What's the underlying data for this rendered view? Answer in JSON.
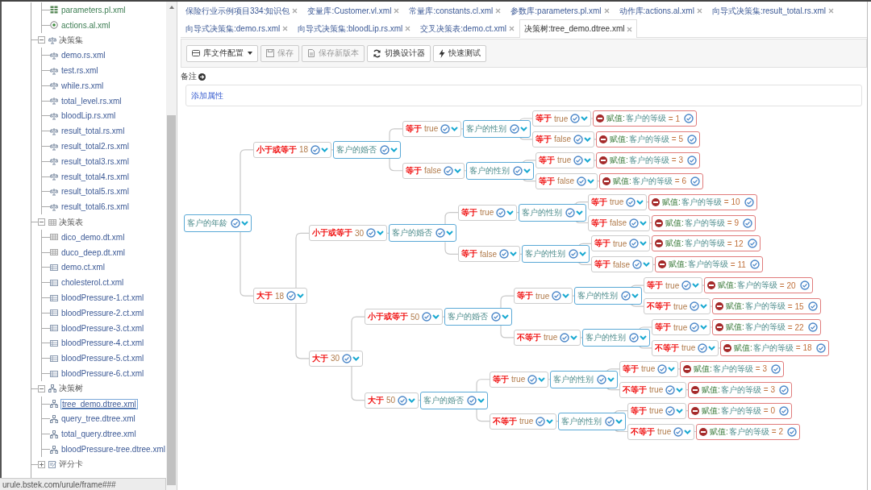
{
  "sidebar": {
    "groups": [
      {
        "children": [
          {
            "label": "parameters.pl.xml",
            "kind": "parameters",
            "selected": false
          },
          {
            "label": "actions.al.xml",
            "kind": "actions",
            "selected": false
          }
        ]
      },
      {
        "label": "决策集",
        "kind": "ruleset",
        "expanded": true,
        "children": [
          {
            "label": "demo.rs.xml",
            "kind": "ruleset",
            "selected": false
          },
          {
            "label": "test.rs.xml",
            "kind": "ruleset",
            "selected": false
          },
          {
            "label": "while.rs.xml",
            "kind": "ruleset",
            "selected": false
          },
          {
            "label": "total_level.rs.xml",
            "kind": "ruleset",
            "selected": false
          },
          {
            "label": "bloodLip.rs.xml",
            "kind": "ruleset",
            "selected": false
          },
          {
            "label": "result_total.rs.xml",
            "kind": "ruleset",
            "selected": false
          },
          {
            "label": "result_total2.rs.xml",
            "kind": "ruleset",
            "selected": false
          },
          {
            "label": "result_total3.rs.xml",
            "kind": "ruleset",
            "selected": false
          },
          {
            "label": "result_total4.rs.xml",
            "kind": "ruleset",
            "selected": false
          },
          {
            "label": "result_total5.rs.xml",
            "kind": "ruleset",
            "selected": false
          },
          {
            "label": "result_total6.rs.xml",
            "kind": "ruleset",
            "selected": false
          }
        ]
      },
      {
        "label": "决策表",
        "kind": "table",
        "expanded": true,
        "children": [
          {
            "label": "dico_demo.dt.xml",
            "kind": "table",
            "selected": false
          },
          {
            "label": "duco_deep.dt.xml",
            "kind": "table",
            "selected": false
          },
          {
            "label": "demo.ct.xml",
            "kind": "crosstab",
            "selected": false
          },
          {
            "label": "cholesterol.ct.xml",
            "kind": "crosstab",
            "selected": false
          },
          {
            "label": "bloodPressure-1.ct.xml",
            "kind": "crosstab",
            "selected": false
          },
          {
            "label": "bloodPressure-2.ct.xml",
            "kind": "crosstab",
            "selected": false
          },
          {
            "label": "bloodPressure-3.ct.xml",
            "kind": "crosstab",
            "selected": false
          },
          {
            "label": "bloodPressure-4.ct.xml",
            "kind": "crosstab",
            "selected": false
          },
          {
            "label": "bloodPressure-5.ct.xml",
            "kind": "crosstab",
            "selected": false
          },
          {
            "label": "bloodPressure-6.ct.xml",
            "kind": "crosstab",
            "selected": false
          }
        ]
      },
      {
        "label": "决策树",
        "kind": "tree",
        "expanded": true,
        "children": [
          {
            "label": "tree_demo.dtree.xml",
            "kind": "tree",
            "selected": true
          },
          {
            "label": "query_tree.dtree.xml",
            "kind": "tree",
            "selected": false
          },
          {
            "label": "total_query.dtree.xml",
            "kind": "tree",
            "selected": false
          },
          {
            "label": "bloodPressure-tree.dtree.xml",
            "kind": "tree",
            "selected": false
          }
        ]
      },
      {
        "label": "评分卡",
        "kind": "scorecard",
        "expanded": false
      }
    ]
  },
  "status_bar": "urule.bstek.com/urule/frame###",
  "tab_rows": [
    [
      {
        "label": "保险行业示例项目334:知识包",
        "selected": false
      },
      {
        "label": "变量库:Customer.vl.xml",
        "selected": false
      },
      {
        "label": "常量库:constants.cl.xml",
        "selected": false
      },
      {
        "label": "参数库:parameters.pl.xml",
        "selected": false
      },
      {
        "label": "动作库:actions.al.xml",
        "selected": false
      },
      {
        "label": "向导式决策集:result_total.rs.xml",
        "selected": false
      }
    ],
    [
      {
        "label": "向导式决策集:demo.rs.xml",
        "selected": false
      },
      {
        "label": "向导式决策集:bloodLip.rs.xml",
        "selected": false
      },
      {
        "label": "交叉决策表:demo.ct.xml",
        "selected": false
      },
      {
        "label": "决策树:tree_demo.dtree.xml",
        "selected": true
      }
    ]
  ],
  "toolbar": [
    {
      "label": "库文件配置",
      "kind": "menu",
      "disabled": false
    },
    {
      "label": "保存",
      "kind": "save",
      "disabled": true
    },
    {
      "label": "保存新版本",
      "kind": "save-as",
      "disabled": true
    },
    {
      "label": "切换设计器",
      "kind": "switch",
      "disabled": false
    },
    {
      "label": "快速测试",
      "kind": "run",
      "disabled": false
    }
  ],
  "note": {
    "label": "备注",
    "add_link": "添加属性"
  },
  "decision_tree": {
    "kind": "variable",
    "label": "客户的年龄",
    "children": [
      {
        "kind": "condition",
        "operator": "小于或等于",
        "value": "18",
        "children": [
          {
            "kind": "variable",
            "label": "客户的婚否",
            "children": [
              {
                "kind": "condition",
                "operator": "等于",
                "value": "true",
                "children": [
                  {
                    "kind": "variable",
                    "label": "客户的性别",
                    "children": [
                      {
                        "kind": "condition",
                        "operator": "等于",
                        "value": "true",
                        "children": [
                          {
                            "kind": "action",
                            "label": "赋值:",
                            "target": "客户的等级",
                            "value": "= 1"
                          }
                        ]
                      },
                      {
                        "kind": "condition",
                        "operator": "等于",
                        "value": "false",
                        "children": [
                          {
                            "kind": "action",
                            "label": "赋值:",
                            "target": "客户的等级",
                            "value": "= 5"
                          }
                        ]
                      }
                    ]
                  }
                ]
              },
              {
                "kind": "condition",
                "operator": "等于",
                "value": "false",
                "children": [
                  {
                    "kind": "variable",
                    "label": "客户的性别",
                    "children": [
                      {
                        "kind": "condition",
                        "operator": "等于",
                        "value": "true",
                        "children": [
                          {
                            "kind": "action",
                            "label": "赋值:",
                            "target": "客户的等级",
                            "value": "= 3"
                          }
                        ]
                      },
                      {
                        "kind": "condition",
                        "operator": "等于",
                        "value": "false",
                        "children": [
                          {
                            "kind": "action",
                            "label": "赋值:",
                            "target": "客户的等级",
                            "value": "= 6"
                          }
                        ]
                      }
                    ]
                  }
                ]
              }
            ]
          }
        ]
      },
      {
        "kind": "condition",
        "operator": "大于",
        "value": "18",
        "children": [
          {
            "kind": "condition",
            "operator": "小于或等于",
            "value": "30",
            "children": [
              {
                "kind": "variable",
                "label": "客户的婚否",
                "children": [
                  {
                    "kind": "condition",
                    "operator": "等于",
                    "value": "true",
                    "children": [
                      {
                        "kind": "variable",
                        "label": "客户的性别",
                        "children": [
                          {
                            "kind": "condition",
                            "operator": "等于",
                            "value": "true",
                            "children": [
                              {
                                "kind": "action",
                                "label": "赋值:",
                                "target": "客户的等级",
                                "value": "= 10"
                              }
                            ]
                          },
                          {
                            "kind": "condition",
                            "operator": "等于",
                            "value": "false",
                            "children": [
                              {
                                "kind": "action",
                                "label": "赋值:",
                                "target": "客户的等级",
                                "value": "= 9"
                              }
                            ]
                          }
                        ]
                      }
                    ]
                  },
                  {
                    "kind": "condition",
                    "operator": "等于",
                    "value": "false",
                    "children": [
                      {
                        "kind": "variable",
                        "label": "客户的性别",
                        "children": [
                          {
                            "kind": "condition",
                            "operator": "等于",
                            "value": "true",
                            "children": [
                              {
                                "kind": "action",
                                "label": "赋值:",
                                "target": "客户的等级",
                                "value": "= 12"
                              }
                            ]
                          },
                          {
                            "kind": "condition",
                            "operator": "等于",
                            "value": "false",
                            "children": [
                              {
                                "kind": "action",
                                "label": "赋值:",
                                "target": "客户的等级",
                                "value": "= 11"
                              }
                            ]
                          }
                        ]
                      }
                    ]
                  }
                ]
              }
            ]
          },
          {
            "kind": "condition",
            "operator": "大于",
            "value": "30",
            "children": [
              {
                "kind": "condition",
                "operator": "小于或等于",
                "value": "50",
                "children": [
                  {
                    "kind": "variable",
                    "label": "客户的婚否",
                    "children": [
                      {
                        "kind": "condition",
                        "operator": "等于",
                        "value": "true",
                        "children": [
                          {
                            "kind": "variable",
                            "label": "客户的性别",
                            "children": [
                              {
                                "kind": "condition",
                                "operator": "等于",
                                "value": "true",
                                "children": [
                                  {
                                    "kind": "action",
                                    "label": "赋值:",
                                    "target": "客户的等级",
                                    "value": "= 20"
                                  }
                                ]
                              },
                              {
                                "kind": "condition",
                                "operator": "不等于",
                                "value": "true",
                                "children": [
                                  {
                                    "kind": "action",
                                    "label": "赋值:",
                                    "target": "客户的等级",
                                    "value": "= 15"
                                  }
                                ]
                              }
                            ]
                          }
                        ]
                      },
                      {
                        "kind": "condition",
                        "operator": "不等于",
                        "value": "true",
                        "children": [
                          {
                            "kind": "variable",
                            "label": "客户的性别",
                            "children": [
                              {
                                "kind": "condition",
                                "operator": "等于",
                                "value": "true",
                                "children": [
                                  {
                                    "kind": "action",
                                    "label": "赋值:",
                                    "target": "客户的等级",
                                    "value": "= 22"
                                  }
                                ]
                              },
                              {
                                "kind": "condition",
                                "operator": "不等于",
                                "value": "true",
                                "children": [
                                  {
                                    "kind": "action",
                                    "label": "赋值:",
                                    "target": "客户的等级",
                                    "value": "= 18"
                                  }
                                ]
                              }
                            ]
                          }
                        ]
                      }
                    ]
                  }
                ]
              },
              {
                "kind": "condition",
                "operator": "大于",
                "value": "50",
                "children": [
                  {
                    "kind": "variable",
                    "label": "客户的婚否",
                    "children": [
                      {
                        "kind": "condition",
                        "operator": "等于",
                        "value": "true",
                        "children": [
                          {
                            "kind": "variable",
                            "label": "客户的性别",
                            "children": [
                              {
                                "kind": "condition",
                                "operator": "等于",
                                "value": "true",
                                "children": [
                                  {
                                    "kind": "action",
                                    "label": "赋值:",
                                    "target": "客户的等级",
                                    "value": "= 3"
                                  }
                                ]
                              },
                              {
                                "kind": "condition",
                                "operator": "不等于",
                                "value": "true",
                                "children": [
                                  {
                                    "kind": "action",
                                    "label": "赋值:",
                                    "target": "客户的等级",
                                    "value": "= 3"
                                  }
                                ]
                              }
                            ]
                          }
                        ]
                      },
                      {
                        "kind": "condition",
                        "operator": "不等于",
                        "value": "true",
                        "children": [
                          {
                            "kind": "variable",
                            "label": "客户的性别",
                            "children": [
                              {
                                "kind": "condition",
                                "operator": "等于",
                                "value": "true",
                                "children": [
                                  {
                                    "kind": "action",
                                    "label": "赋值:",
                                    "target": "客户的等级",
                                    "value": "= 0"
                                  }
                                ]
                              },
                              {
                                "kind": "condition",
                                "operator": "不等于",
                                "value": "true",
                                "children": [
                                  {
                                    "kind": "action",
                                    "label": "赋值:",
                                    "target": "客户的等级",
                                    "value": "= 2"
                                  }
                                ]
                              }
                            ]
                          }
                        ]
                      }
                    ]
                  }
                ]
              }
            ]
          }
        ]
      }
    ]
  }
}
